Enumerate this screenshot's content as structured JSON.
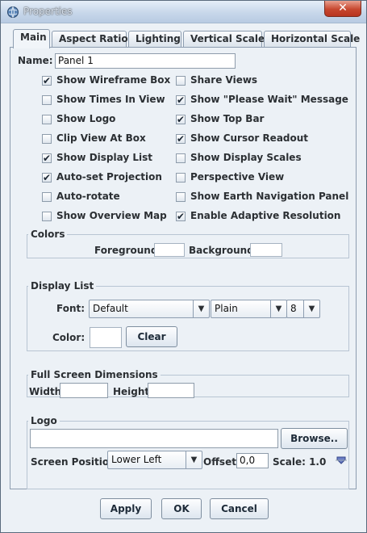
{
  "window": {
    "title": "Properties",
    "close_glyph": "✕"
  },
  "tabs": [
    {
      "label": "Main",
      "active": true
    },
    {
      "label": "Aspect Ratio"
    },
    {
      "label": "Lighting"
    },
    {
      "label": "Vertical Scale"
    },
    {
      "label": "Horizontal Scale"
    }
  ],
  "main": {
    "name_label": "Name:",
    "name_value": "Panel 1",
    "checkboxes_left": [
      {
        "label": "Show Wireframe Box",
        "checked": true
      },
      {
        "label": "Show Times In View",
        "checked": false
      },
      {
        "label": "Show Logo",
        "checked": false
      },
      {
        "label": "Clip View At Box",
        "checked": false
      },
      {
        "label": "Show Display List",
        "checked": true
      },
      {
        "label": "Auto-set Projection",
        "checked": true
      },
      {
        "label": "Auto-rotate",
        "checked": false
      },
      {
        "label": "Show Overview Map",
        "checked": false
      }
    ],
    "checkboxes_right": [
      {
        "label": "Share Views",
        "checked": false
      },
      {
        "label": "Show \"Please Wait\" Message",
        "checked": true
      },
      {
        "label": "Show Top Bar",
        "checked": true
      },
      {
        "label": "Show Cursor Readout",
        "checked": true
      },
      {
        "label": "Show Display Scales",
        "checked": false
      },
      {
        "label": "Perspective View",
        "checked": false
      },
      {
        "label": "Show Earth Navigation Panel",
        "checked": false
      },
      {
        "label": "Enable Adaptive Resolution",
        "checked": true
      }
    ],
    "colors": {
      "legend": "Colors",
      "foreground_label": "Foreground:",
      "background_label": "Background:",
      "foreground_color": "#ffffff",
      "background_color": "#ffffff"
    },
    "display_list": {
      "legend": "Display List",
      "font_label": "Font:",
      "font_value": "Default",
      "style_value": "Plain",
      "size_value": "8",
      "color_label": "Color:",
      "clear_button": "Clear",
      "dropdown_glyph": "▼"
    },
    "full_screen": {
      "legend": "Full Screen Dimensions",
      "width_label": "Width:",
      "height_label": "Height:",
      "width_value": "",
      "height_value": ""
    },
    "logo": {
      "legend": "Logo",
      "path_value": "",
      "browse_button": "Browse..",
      "screen_position_label": "Screen Position:",
      "screen_position_value": "Lower Left",
      "offset_label": "Offset:",
      "offset_value": "0,0",
      "scale_label": "Scale: 1.0"
    }
  },
  "buttons": {
    "apply": "Apply",
    "ok": "OK",
    "cancel": "Cancel"
  },
  "theme": {
    "accent": "#3b5c85",
    "check_color": "#1c2733"
  }
}
